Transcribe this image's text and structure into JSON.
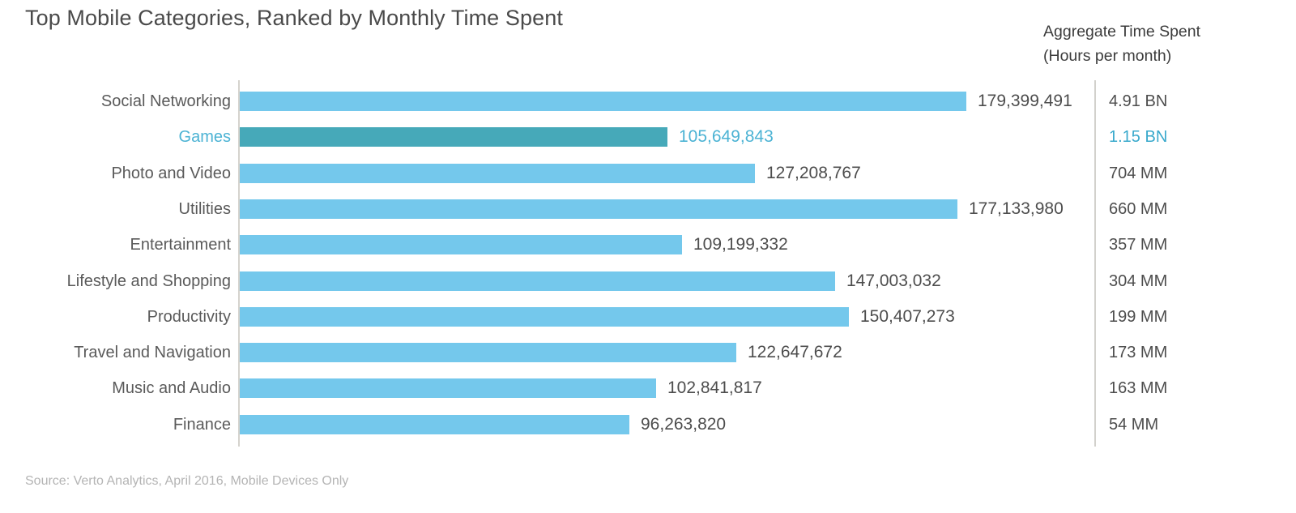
{
  "title": "Top Mobile Categories, Ranked by Monthly Time Spent",
  "right_header": {
    "line1": "Aggregate Time Spent",
    "line2": "(Hours per month)"
  },
  "source": "Source: Verto Analytics, April 2016, Mobile Devices Only",
  "colors": {
    "bar": "#74c8ec",
    "bar_highlight": "#46a9b9",
    "label": "#5a5a5a",
    "label_highlight": "#4cb3d4",
    "title": "#4a4a4a",
    "source": "#b4b4b4",
    "axis": "#d5d3cd"
  },
  "chart_data": {
    "type": "bar",
    "orientation": "horizontal",
    "title": "Top Mobile Categories, Ranked by Monthly Time Spent",
    "xlabel": "",
    "ylabel": "",
    "grid": false,
    "legend": "none",
    "axis_range": [
      0,
      200000000
    ],
    "value_unit": "monthly users",
    "categories": [
      "Social Networking",
      "Games",
      "Photo and Video",
      "Utilities",
      "Entertainment",
      "Lifestyle and Shopping",
      "Productivity",
      "Travel and Navigation",
      "Music and Audio",
      "Finance"
    ],
    "values": [
      179399491,
      105649843,
      127208767,
      177133980,
      109199332,
      147003032,
      150407273,
      122647672,
      102841817,
      96263820
    ],
    "value_labels": [
      "179,399,491",
      "105,649,843",
      "127,208,767",
      "177,133,980",
      "109,199,332",
      "147,003,032",
      "150,407,273",
      "122,647,672",
      "102,841,817",
      "96,263,820"
    ],
    "secondary_series": {
      "name": "Aggregate Time Spent (Hours per month)",
      "labels": [
        "4.91 BN",
        "1.15 BN",
        "704 MM",
        "660 MM",
        "357 MM",
        "304 MM",
        "199 MM",
        "173 MM",
        "163 MM",
        "54 MM"
      ],
      "values_hours": [
        4910000000,
        1150000000,
        704000000,
        660000000,
        357000000,
        304000000,
        199000000,
        173000000,
        163000000,
        54000000
      ]
    },
    "highlight_index": 1,
    "annotations": []
  }
}
